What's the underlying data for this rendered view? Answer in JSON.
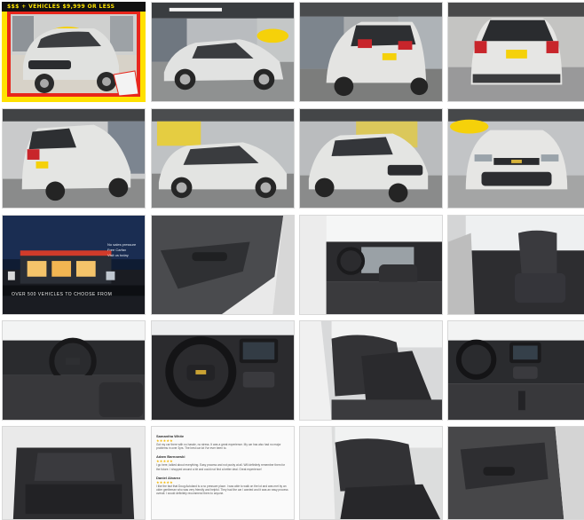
{
  "promo_banner": "$$$ + VEHICLES $9,999 OR LESS",
  "dealer": {
    "caption": "OVER 500 VEHICLES TO CHOOSE FROM",
    "side_lines": [
      "No sales pressure",
      "Free Carfax",
      "",
      "Visit us today"
    ]
  },
  "reviews": [
    {
      "name": "Samantha White",
      "stars": "★★★★★",
      "text": "Got my car there with no hassle, no stress. It was a great experience. My car has also had no major problems in over 3yrs. The best car lot I've ever been to."
    },
    {
      "name": "Adam Barnowski",
      "stars": "★★★★★",
      "text": "I go here, talked about everything. Easy process and not pushy at all. Will definitely remember them for the future. I shopped around a bit and could not find a better deal. Great experience!"
    },
    {
      "name": "Daniel Alvarez",
      "stars": "★★★★★",
      "text": "I like the fact that Doug Autoland is a no pressure place. I was able to walk on the lot and was met by an older gentleman who was very friendly and helpful. They had the car I wanted and it was an easy process overall. I would definitely recommend them to anyone."
    }
  ],
  "colors": {
    "promo_frame_red": "#e8261b",
    "promo_frame_yellow": "#ffe100",
    "car_silver": "#d9d9d6",
    "interior_dark": "#2b2b2e",
    "logo_yellow": "#f5d10a"
  }
}
